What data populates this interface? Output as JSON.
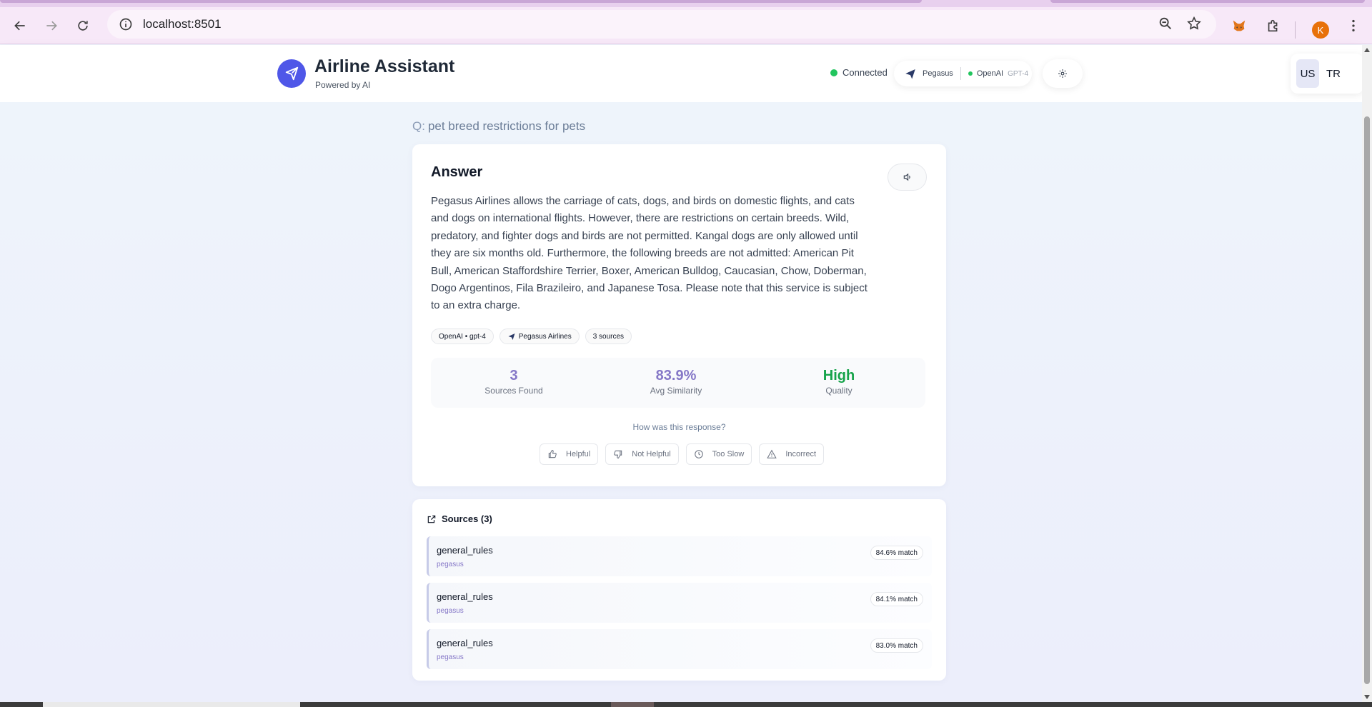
{
  "browser": {
    "url": "localhost:8501",
    "profile_initial": "K"
  },
  "header": {
    "title": "Airline Assistant",
    "subtitle": "Powered by AI",
    "status": "Connected",
    "airline": "Pegasus",
    "provider": "OpenAI",
    "model": "GPT-4",
    "languages": [
      "US",
      "TR"
    ],
    "active_language": "US"
  },
  "query": {
    "prefix": "Q:",
    "text": "pet breed restrictions for pets"
  },
  "answer": {
    "title": "Answer",
    "text": "Pegasus Airlines allows the carriage of cats, dogs, and birds on domestic flights, and cats and dogs on international flights. However, there are restrictions on certain breeds. Wild, predatory, and fighter dogs and birds are not permitted. Kangal dogs are only allowed until they are six months old. Furthermore, the following breeds are not admitted: American Pit Bull, American Staffordshire Terrier, Boxer, American Bulldog, Caucasian, Chow, Doberman, Dogo Argentinos, Fila Brazileiro, and Japanese Tosa. Please note that this service is subject to an extra charge.",
    "chips": [
      "OpenAI • gpt-4",
      "Pegasus Airlines",
      "3 sources"
    ]
  },
  "stats": [
    {
      "value": "3",
      "label": "Sources Found"
    },
    {
      "value": "83.9%",
      "label": "Avg Similarity"
    },
    {
      "value": "High",
      "label": "Quality"
    }
  ],
  "feedback": {
    "question": "How was this response?",
    "buttons": [
      "Helpful",
      "Not Helpful",
      "Too Slow",
      "Incorrect"
    ]
  },
  "sources": {
    "title": "Sources (3)",
    "items": [
      {
        "name": "general_rules",
        "airline": "pegasus",
        "match": "84.6% match"
      },
      {
        "name": "general_rules",
        "airline": "pegasus",
        "match": "84.1% match"
      },
      {
        "name": "general_rules",
        "airline": "pegasus",
        "match": "83.0% match"
      }
    ]
  },
  "colors": {
    "brand": "#4f57e8",
    "accent_purple": "#8577c7",
    "quality_green": "#16a34a",
    "status_green": "#22c55e"
  }
}
